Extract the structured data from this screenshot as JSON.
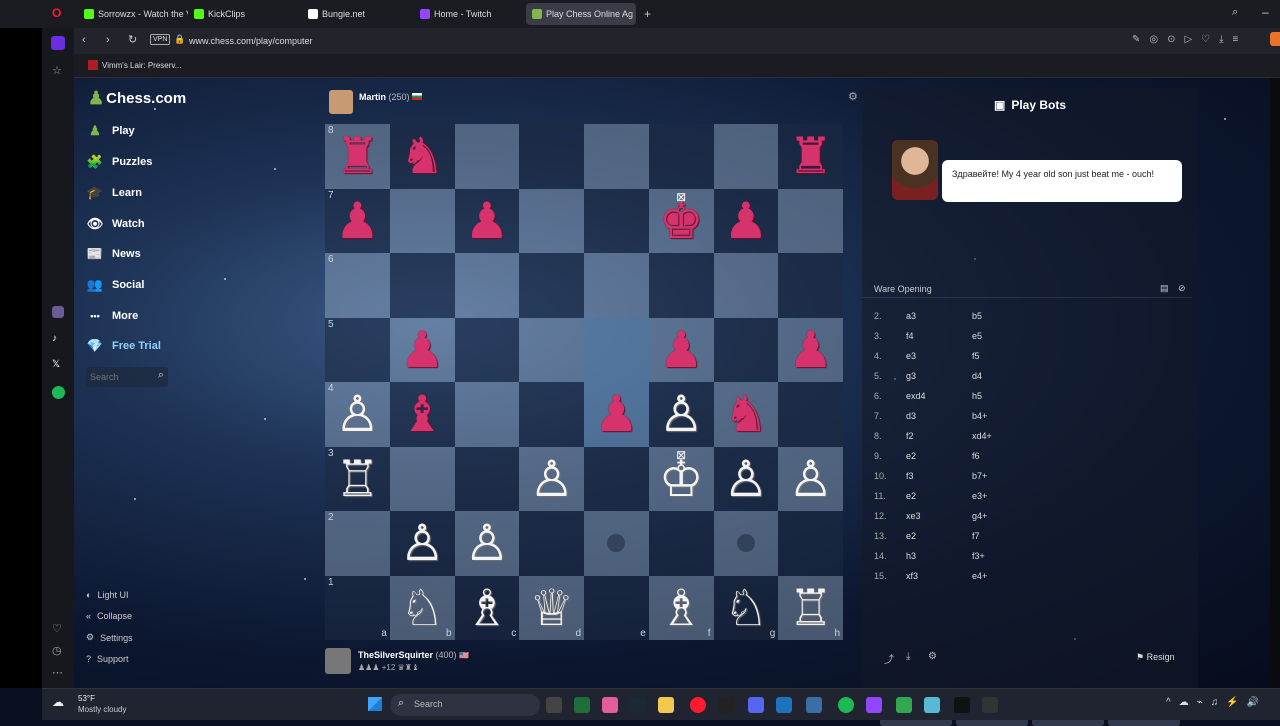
{
  "browser": {
    "tabs": [
      {
        "label": "Sorrowzx - Watch the VOD",
        "color": "#53fc18"
      },
      {
        "label": "KickClips",
        "color": "#53fc18"
      },
      {
        "label": "Bungie.net",
        "color": "#ffffff"
      },
      {
        "label": "Home - Twitch",
        "color": "#9146ff"
      },
      {
        "label": "Play Chess Online Ag",
        "color": "#81b64c"
      }
    ],
    "url": "www.chess.com/play/computer",
    "vpn_label": "VPN",
    "bookmark": "Vimm's Lair: Preserv..."
  },
  "sidebar": {
    "logo": "Chess.com",
    "items": [
      {
        "label": "Play",
        "icon": "♟"
      },
      {
        "label": "Puzzles",
        "icon": "🧩"
      },
      {
        "label": "Learn",
        "icon": "🎓"
      },
      {
        "label": "Watch",
        "icon": "👁"
      },
      {
        "label": "News",
        "icon": "📰"
      },
      {
        "label": "Social",
        "icon": "👥"
      },
      {
        "label": "More",
        "icon": "•••"
      },
      {
        "label": "Free Trial",
        "icon": "💎"
      }
    ],
    "search_placeholder": "Search",
    "bottom": [
      {
        "label": "Light UI",
        "icon": "◐"
      },
      {
        "label": "Collapse",
        "icon": "«"
      },
      {
        "label": "Settings",
        "icon": "⚙"
      },
      {
        "label": "Support",
        "icon": "?"
      }
    ]
  },
  "opponent": {
    "name": "Martin",
    "rating": "(250)"
  },
  "player": {
    "name": "TheSilverSquirter",
    "rating": "(400)",
    "advantage": "+12"
  },
  "board": {
    "rows": [
      [
        "♜",
        "♞",
        "",
        "",
        "",
        "",
        "",
        "♜"
      ],
      [
        "♟",
        "",
        "♟",
        "",
        "",
        "♚",
        "♟",
        ""
      ],
      [
        "",
        "",
        "",
        "",
        "",
        "",
        "",
        ""
      ],
      [
        "",
        "♟",
        "",
        "",
        "",
        "♟",
        "",
        "♟"
      ],
      [
        "♙",
        "♝",
        "",
        "",
        "♟",
        "♙",
        "♞",
        ""
      ],
      [
        "♖",
        "",
        "",
        "♙",
        "",
        "♔",
        "♙",
        "♙"
      ],
      [
        "",
        "♙",
        "♙",
        "",
        "",
        "",
        "",
        ""
      ],
      [
        "",
        "♘",
        "♗",
        "♕",
        "",
        "♗",
        "♘",
        "♖"
      ]
    ],
    "colors": [
      [
        "b",
        "b",
        "",
        "",
        "",
        "",
        "",
        "b"
      ],
      [
        "b",
        "",
        "b",
        "",
        "",
        "b",
        "b",
        ""
      ],
      [
        "",
        "",
        "",
        "",
        "",
        "",
        "",
        ""
      ],
      [
        "",
        "b",
        "",
        "",
        "",
        "b",
        "",
        "b"
      ],
      [
        "w",
        "b",
        "",
        "",
        "b",
        "w",
        "b",
        ""
      ],
      [
        "w",
        "",
        "",
        "w",
        "",
        "w",
        "w",
        "w"
      ],
      [
        "",
        "w",
        "w",
        "",
        "",
        "",
        "",
        ""
      ],
      [
        "",
        "w",
        "w",
        "w",
        "",
        "w",
        "w",
        "w"
      ]
    ],
    "ranks": [
      "8",
      "7",
      "6",
      "5",
      "4",
      "3",
      "2",
      "1"
    ],
    "files": [
      "a",
      "b",
      "c",
      "d",
      "e",
      "f",
      "g",
      "h"
    ]
  },
  "panel": {
    "title": "Play Bots",
    "chat": "Здравейте! My 4 year old son just beat me - ouch!",
    "opening": "Ware Opening",
    "moves": [
      {
        "n": "2.",
        "w": "a3",
        "b": "b5"
      },
      {
        "n": "3.",
        "w": "f4",
        "b": "e5"
      },
      {
        "n": "4.",
        "w": "e3",
        "b": "f5"
      },
      {
        "n": "5.",
        "w": "g3",
        "b": "d4"
      },
      {
        "n": "6.",
        "w": "exd4",
        "b": "h5"
      },
      {
        "n": "7.",
        "w": "d3",
        "b": "b4+"
      },
      {
        "n": "8.",
        "w": "f2",
        "b": "xd4+"
      },
      {
        "n": "9.",
        "w": "e2",
        "b": "f6"
      },
      {
        "n": "10.",
        "w": "f3",
        "b": "b7+"
      },
      {
        "n": "11.",
        "w": "e2",
        "b": "e3+"
      },
      {
        "n": "12.",
        "w": "xe3",
        "b": "g4+"
      },
      {
        "n": "13.",
        "w": "e2",
        "b": "f7"
      },
      {
        "n": "14.",
        "w": "h3",
        "b": "f3+"
      },
      {
        "n": "15.",
        "w": "xf3",
        "b": "e4+"
      }
    ],
    "resign": "Resign"
  },
  "taskbar": {
    "weather_temp": "53°F",
    "weather_desc": "Mostly cloudy",
    "search_placeholder": "Search"
  }
}
